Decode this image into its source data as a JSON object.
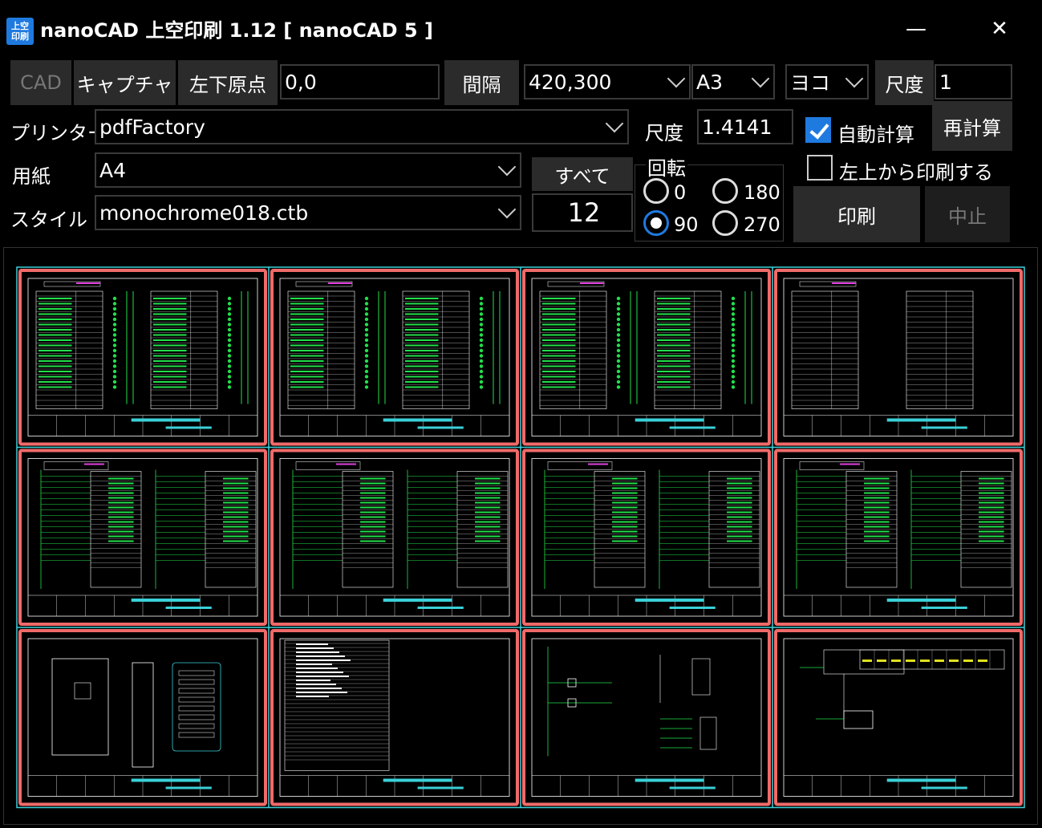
{
  "window": {
    "icon_text": "上空\n印刷",
    "title": "nanoCAD 上空印刷 1.12 [ nanoCAD 5 ]",
    "minimize_label": "—",
    "close_label": "✕"
  },
  "toolbar": {
    "cad_label": "CAD",
    "capture_label": "キャプチャ",
    "origin_label": "左下原点",
    "origin_value": "0,0",
    "interval_label": "間隔",
    "interval_value": "420,300",
    "paper_size_value": "A3",
    "orientation_value": "ヨコ",
    "scale_label": "尺度",
    "scale_value": "1"
  },
  "settings": {
    "printer_label": "プリンター",
    "printer_value": "pdfFactory",
    "paper_label": "用紙",
    "paper_value": "A4",
    "style_label": "スタイル",
    "style_value": "monochrome018.ctb",
    "all_label": "すべて",
    "page_count": "12",
    "scale2_label": "尺度",
    "scale2_value": "1.4141",
    "autocalc_label": "自動計算",
    "autocalc_checked": true,
    "recalc_label": "再計算",
    "topleft_label": "左上から印刷する",
    "topleft_checked": false,
    "rotation_label": "回転",
    "rotation_options": [
      "0",
      "180",
      "90",
      "270"
    ],
    "rotation_selected": "90",
    "print_label": "印刷",
    "stop_label": "中止"
  },
  "preview": {
    "rows": 3,
    "cols": 4,
    "page_border_color": "#f06a6a",
    "grid_line_color": "#3ad0d8",
    "drawing_color": "#22e04a",
    "pages": [
      {
        "kind": "ladder"
      },
      {
        "kind": "ladder"
      },
      {
        "kind": "ladder"
      },
      {
        "kind": "table"
      },
      {
        "kind": "wiring"
      },
      {
        "kind": "wiring"
      },
      {
        "kind": "wiring"
      },
      {
        "kind": "wiring"
      },
      {
        "kind": "panel"
      },
      {
        "kind": "list"
      },
      {
        "kind": "schematic"
      },
      {
        "kind": "block"
      }
    ]
  }
}
